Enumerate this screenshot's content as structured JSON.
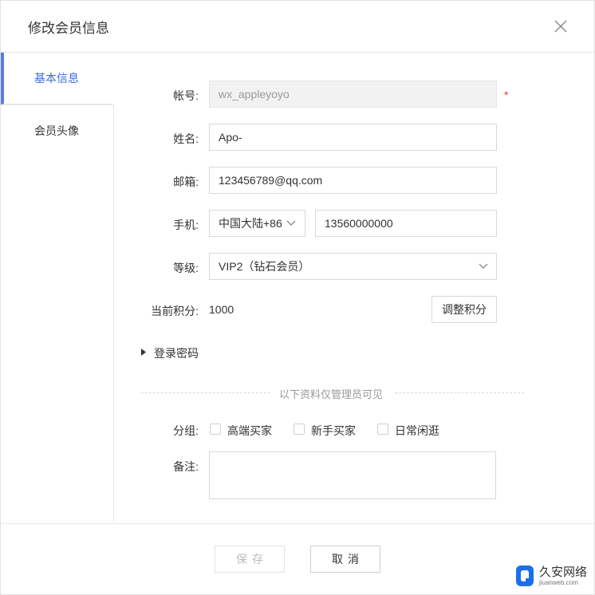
{
  "dialog": {
    "title": "修改会员信息"
  },
  "sidebar": {
    "items": [
      {
        "label": "基本信息"
      },
      {
        "label": "会员头像"
      }
    ]
  },
  "form": {
    "account": {
      "label": "帐号:",
      "value": "wx_appleyoyo",
      "required_mark": "*"
    },
    "name": {
      "label": "姓名:",
      "value": "Apo-"
    },
    "email": {
      "label": "邮箱:",
      "value": "123456789@qq.com"
    },
    "phone": {
      "label": "手机:",
      "region": "中国大陆+86",
      "value": "13560000000"
    },
    "level": {
      "label": "等级:",
      "value": "VIP2（钻石会员）"
    },
    "points": {
      "label": "当前积分:",
      "value": "1000",
      "adjust_label": "调整积分"
    },
    "password": {
      "label": "登录密码"
    },
    "admin_divider": "以下资料仅管理员可见",
    "group": {
      "label": "分组:",
      "options": [
        {
          "label": "高端买家"
        },
        {
          "label": "新手买家"
        },
        {
          "label": "日常闲逛"
        }
      ]
    },
    "remark": {
      "label": "备注:",
      "value": ""
    }
  },
  "footer": {
    "save_label": "保存",
    "cancel_label": "取消"
  },
  "watermark": {
    "name": "久安网络",
    "url": "jiuanweb.com"
  },
  "colors": {
    "accent": "#3a6cd6",
    "required": "#e0393e"
  }
}
